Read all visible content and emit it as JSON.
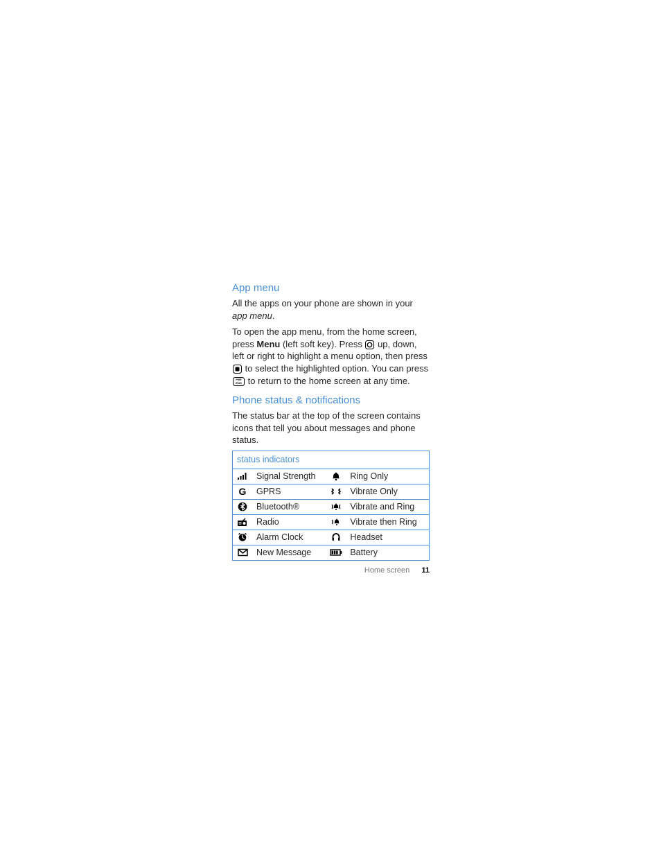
{
  "section1": {
    "heading": "App menu",
    "p1_a": "All the apps on your phone are shown in your ",
    "p1_b": "app menu",
    "p1_c": ".",
    "p2_a": "To open the app menu, from the home screen, press ",
    "p2_b": "Menu",
    "p2_c": " (left soft key). Press ",
    "p2_d": " up, down, left or right to highlight a menu option, then press ",
    "p2_e": " to select the highlighted option. You can press ",
    "p2_f": " to return to the home screen at any time."
  },
  "section2": {
    "heading": "Phone status & notifications",
    "p1": "The status bar at the top of the screen contains icons that tell you about messages and phone status."
  },
  "table": {
    "header": "status indicators",
    "rows": [
      {
        "l": "Signal Strength",
        "r": "Ring Only"
      },
      {
        "l": "GPRS",
        "r": "Vibrate Only"
      },
      {
        "l": "Bluetooth®",
        "r": "Vibrate and Ring"
      },
      {
        "l": "Radio",
        "r": "Vibrate then Ring"
      },
      {
        "l": "Alarm Clock",
        "r": "Headset"
      },
      {
        "l": "New Message",
        "r": "Battery"
      }
    ]
  },
  "footer": {
    "section": "Home screen",
    "page": "11"
  }
}
